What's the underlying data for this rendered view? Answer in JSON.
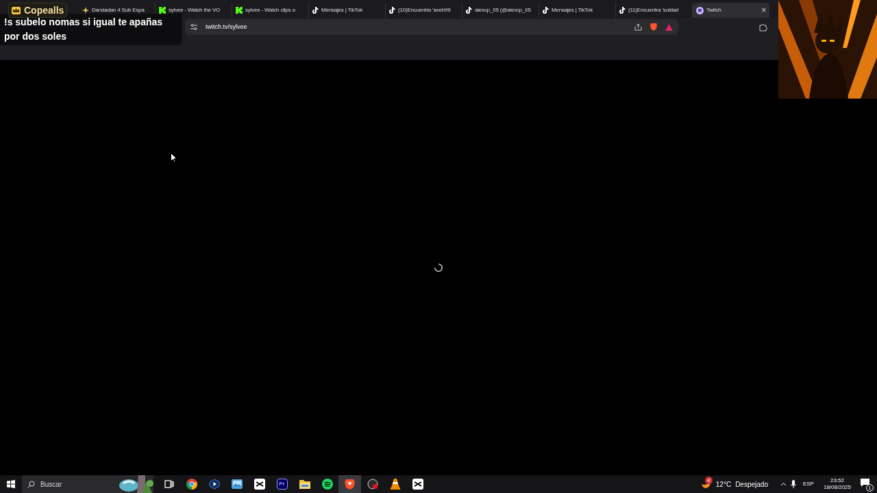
{
  "tabs": [
    {
      "title": "Dandadan 4 Sub Espa",
      "kind": "star",
      "selected": false
    },
    {
      "title": "sylvee - Watch the VO",
      "kind": "kick",
      "selected": false
    },
    {
      "title": "sylvee - Watch clips o",
      "kind": "kick",
      "selected": false
    },
    {
      "title": "Mensajes | TikTok",
      "kind": "tiktok",
      "selected": false
    },
    {
      "title": "(10)Encuentra 'seeb99",
      "kind": "tiktok",
      "selected": false
    },
    {
      "title": "alexcp_05 (@alexcp_05",
      "kind": "tiktok",
      "selected": false
    },
    {
      "title": "Mensajes | TikTok",
      "kind": "tiktok",
      "selected": false
    },
    {
      "title": "(11)Encuentra 'soldad",
      "kind": "tiktok",
      "selected": false
    },
    {
      "title": "Twitch",
      "kind": "twitch",
      "selected": true,
      "close": "×"
    }
  ],
  "address_bar": {
    "url": "twitch.tv/sylvee"
  },
  "overlay": {
    "badge": "Copealls",
    "message": "!s subelo nomas si igual te apañas por dos soles"
  },
  "content": {
    "loading": true
  },
  "taskbar": {
    "search": {
      "placeholder": "Buscar"
    },
    "apps": [
      {
        "kind": "taskview",
        "active": false
      },
      {
        "kind": "chrome",
        "active": false
      },
      {
        "kind": "player",
        "active": false
      },
      {
        "kind": "photos",
        "active": false
      },
      {
        "kind": "capcut",
        "active": false
      },
      {
        "kind": "premiere",
        "label": "Pr",
        "active": false
      },
      {
        "kind": "folder",
        "active": false
      },
      {
        "kind": "spotify",
        "active": false
      },
      {
        "kind": "brave",
        "active": true
      },
      {
        "kind": "recorder",
        "active": false
      },
      {
        "kind": "vlc",
        "active": false
      },
      {
        "kind": "capcut",
        "active": false
      }
    ],
    "weather": {
      "badge": "4",
      "temperature": "12°C",
      "condition": "Despejado"
    },
    "language": "ESP",
    "time": "23:52",
    "date": "18/08/2025",
    "notifications": "1"
  }
}
